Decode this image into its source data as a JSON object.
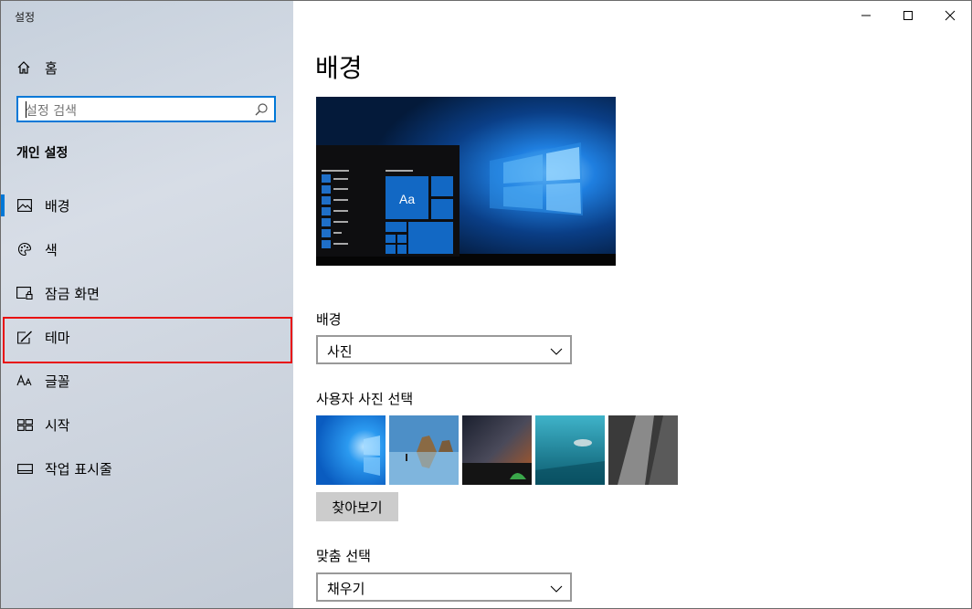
{
  "window": {
    "title": "설정"
  },
  "sidebar": {
    "home_label": "홈",
    "search_placeholder": "설정 검색",
    "section_title": "개인 설정",
    "items": [
      {
        "label": "배경",
        "icon": "image-icon",
        "active": true
      },
      {
        "label": "색",
        "icon": "palette-icon"
      },
      {
        "label": "잠금 화면",
        "icon": "lock-screen-icon"
      },
      {
        "label": "테마",
        "icon": "brush-icon"
      },
      {
        "label": "글꼴",
        "icon": "font-icon"
      },
      {
        "label": "시작",
        "icon": "start-icon"
      },
      {
        "label": "작업 표시줄",
        "icon": "taskbar-icon"
      }
    ]
  },
  "main": {
    "title": "배경",
    "preview_sample_text": "Aa",
    "background_label": "배경",
    "background_value": "사진",
    "choose_picture_label": "사용자 사진 선택",
    "browse_label": "찾아보기",
    "fit_label": "맞춤 선택",
    "fit_value": "채우기"
  },
  "colors": {
    "accent": "#0078d7",
    "highlight": "#e80e0e"
  }
}
